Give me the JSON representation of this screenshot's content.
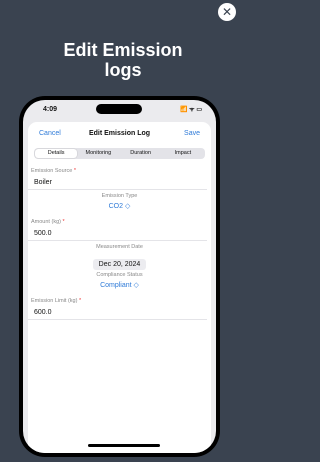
{
  "close_icon_glyph": "✕",
  "headline": "Edit Emission\nlogs",
  "status_bar": {
    "time": "4:09",
    "icons": "📶 ᯤ ▭"
  },
  "nav": {
    "cancel": "Cancel",
    "title": "Edit Emission Log",
    "save": "Save"
  },
  "tabs": [
    "Details",
    "Monitoring",
    "Duration",
    "Impact"
  ],
  "form": {
    "emission_source_label": "Emission Source",
    "emission_source_value": "Boiler",
    "emission_type_label": "Emission Type",
    "emission_type_value": "CO2 ◇",
    "amount_label": "Amount (kg)",
    "amount_value": "500.0",
    "measurement_date_label": "Measurement Date",
    "measurement_date_value": "Dec 20, 2024",
    "compliance_status_label": "Compliance Status",
    "compliance_status_value": "Compliant ◇",
    "emission_limit_label": "Emission Limit (kg)",
    "emission_limit_value": "600.0"
  },
  "required_marker": "*",
  "colors": {
    "background": "#3a4350",
    "accent": "#2f7bd8",
    "required": "#e33333"
  }
}
